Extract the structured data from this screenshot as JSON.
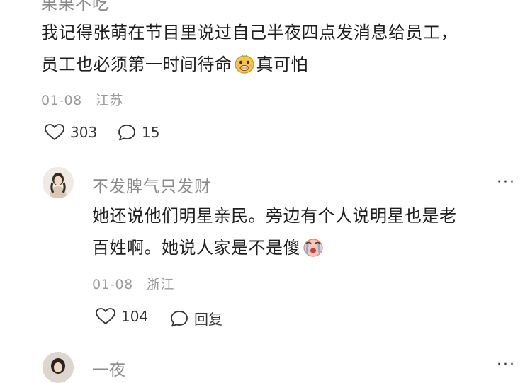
{
  "comment1": {
    "username": "果果不吃",
    "line1": "我记得张萌在节目里说过自己半夜四点发消息给员工，",
    "line2_before": "员工也必须第一时间待命",
    "line2_emoji": "grimace-emoji",
    "line2_after": "真可怕",
    "date": "01-08",
    "location": "江苏",
    "likes": "303",
    "replies": "15"
  },
  "comment2": {
    "username": "不发脾气只发财",
    "line1": "她还说他们明星亲民。旁边有个人说明星也是老",
    "line2_before": "百姓啊。她说人家是不是傻",
    "line2_emoji": "crying-emoji",
    "date": "01-08",
    "location": "浙江",
    "likes": "104",
    "reply_label": "回复",
    "more": "···"
  },
  "comment3": {
    "username": "一夜",
    "more": "···"
  },
  "colors": {
    "text": "#1e1e1e",
    "muted": "#9a9a9a",
    "emoji_yellow": "#f6c744"
  },
  "icons": [
    "heart-icon",
    "comment-bubble-icon",
    "more-icon",
    "grimace-emoji",
    "crying-emoji"
  ]
}
